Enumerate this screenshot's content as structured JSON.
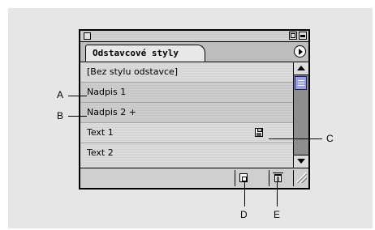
{
  "panel": {
    "tab_label": "Odstavcové styly",
    "rows": [
      {
        "label": "[Bez stylu odstavce]"
      },
      {
        "label": "Nadpis 1"
      },
      {
        "label": "Nadpis 2 +"
      },
      {
        "label": "Text 1"
      },
      {
        "label": "Text 2"
      }
    ]
  },
  "callouts": {
    "a": "A",
    "b": "B",
    "c": "C",
    "d": "D",
    "e": "E"
  }
}
